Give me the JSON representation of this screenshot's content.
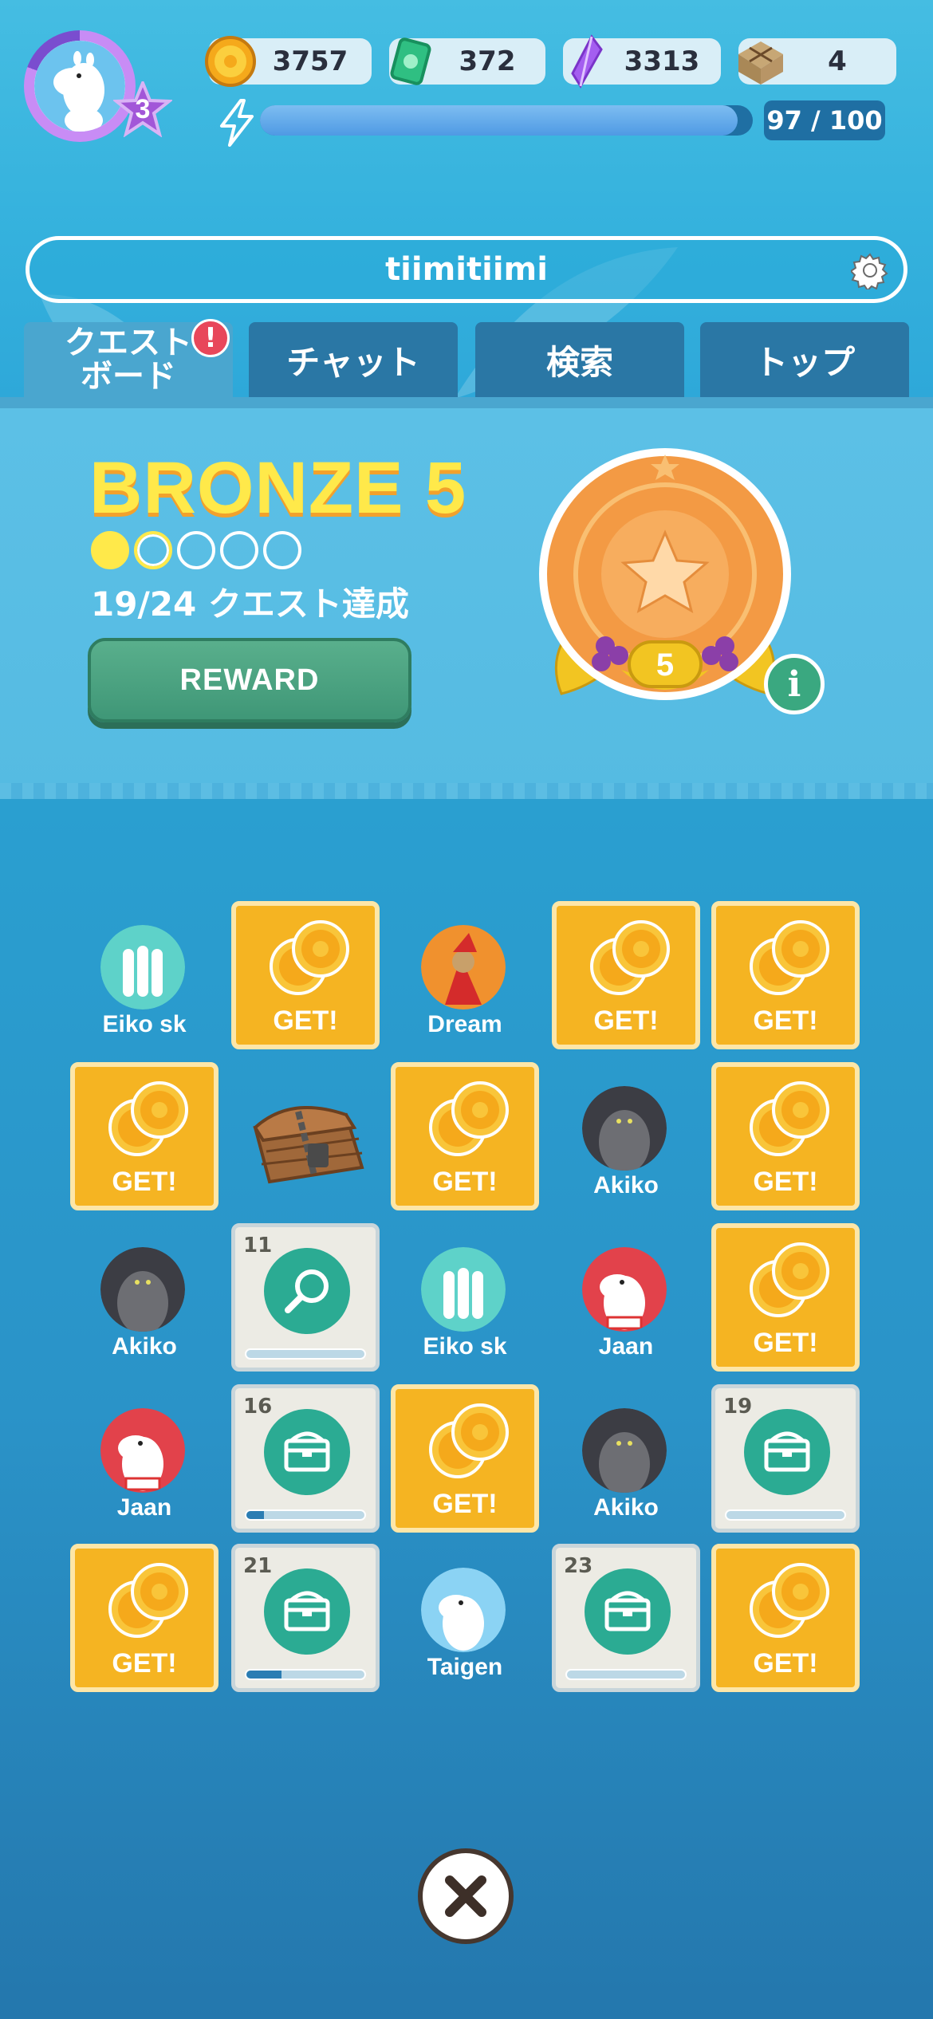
{
  "player": {
    "level": "3"
  },
  "currencies": [
    {
      "name": "coin",
      "icon": "coin-icon",
      "value": "3757"
    },
    {
      "name": "ticket",
      "icon": "ticket-icon",
      "value": "372"
    },
    {
      "name": "crystal",
      "icon": "crystal-icon",
      "value": "3313"
    },
    {
      "name": "parcel",
      "icon": "parcel-icon",
      "value": "4"
    }
  ],
  "energy": {
    "text": "97 / 100",
    "current": 97,
    "max": 100
  },
  "search": {
    "value": "tiimitiimi"
  },
  "tabs": [
    {
      "label": "クエスト\nボード",
      "line1": "クエスト",
      "line2": "ボード",
      "active": true
    },
    {
      "label": "チャット"
    },
    {
      "label": "検索"
    },
    {
      "label": "トップ"
    }
  ],
  "tab_alert": "!",
  "rank": {
    "title": "BRONZE 5",
    "progress_text": "19/24 クエスト達成",
    "dots_filled": 1,
    "dots_partial": 1,
    "dots_total": 5,
    "medal_level": "5",
    "reward_label": "REWARD"
  },
  "board": {
    "get_label": "GET!",
    "cells": [
      {
        "type": "player",
        "name": "Eiko sk",
        "avatar": "hattifattener"
      },
      {
        "type": "coin"
      },
      {
        "type": "player",
        "name": "Dream",
        "avatar": "stinky"
      },
      {
        "type": "coin"
      },
      {
        "type": "coin"
      },
      {
        "type": "coin"
      },
      {
        "type": "chest-locked"
      },
      {
        "type": "coin"
      },
      {
        "type": "player",
        "name": "Akiko",
        "avatar": "groke"
      },
      {
        "type": "coin"
      },
      {
        "type": "player",
        "name": "Akiko",
        "avatar": "groke"
      },
      {
        "type": "quest",
        "number": "11",
        "icon": "magnifier-icon",
        "progress": 0.0
      },
      {
        "type": "player",
        "name": "Eiko sk",
        "avatar": "hattifattener"
      },
      {
        "type": "player",
        "name": "Jaan",
        "avatar": "moomin-red"
      },
      {
        "type": "coin"
      },
      {
        "type": "player",
        "name": "Jaan",
        "avatar": "moomin-red"
      },
      {
        "type": "quest",
        "number": "16",
        "icon": "chest-icon",
        "progress": 0.15
      },
      {
        "type": "coin"
      },
      {
        "type": "player",
        "name": "Akiko",
        "avatar": "groke"
      },
      {
        "type": "quest",
        "number": "19",
        "icon": "chest-icon",
        "progress": 0.0
      },
      {
        "type": "coin"
      },
      {
        "type": "quest",
        "number": "21",
        "icon": "chest-icon",
        "progress": 0.3
      },
      {
        "type": "player",
        "name": "Taigen",
        "avatar": "moomin-blue"
      },
      {
        "type": "quest",
        "number": "23",
        "icon": "chest-icon",
        "progress": 0.0
      },
      {
        "type": "coin"
      }
    ]
  },
  "colors": {
    "coin_tile": "#f5b422",
    "quest_tile": "#ecebe4",
    "rank_title": "#ffe94a",
    "reward_button": "#4aa07f",
    "alert": "#e8475a"
  },
  "close_icon": "close-icon"
}
